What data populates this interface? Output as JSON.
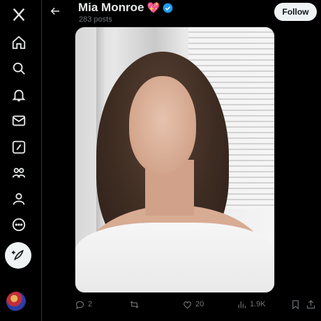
{
  "header": {
    "display_name": "Mia Monroe",
    "name_emoji": "💖",
    "post_count": "283 posts",
    "follow_label": "Follow"
  },
  "sidebar": {
    "items": [
      {
        "name": "x-logo-icon"
      },
      {
        "name": "home-icon"
      },
      {
        "name": "search-icon"
      },
      {
        "name": "notifications-bell-icon"
      },
      {
        "name": "messages-envelope-icon"
      },
      {
        "name": "grok-icon"
      },
      {
        "name": "communities-icon"
      },
      {
        "name": "profile-icon"
      },
      {
        "name": "more-circle-icon"
      }
    ]
  },
  "actions": {
    "replies": "2",
    "reposts": "",
    "likes": "20",
    "views": "1.9K"
  },
  "colors": {
    "background": "#000000",
    "text_primary": "#e7e9ea",
    "text_secondary": "#71767b",
    "verified": "#1d9bf0",
    "follow_bg": "#eff3f4"
  }
}
